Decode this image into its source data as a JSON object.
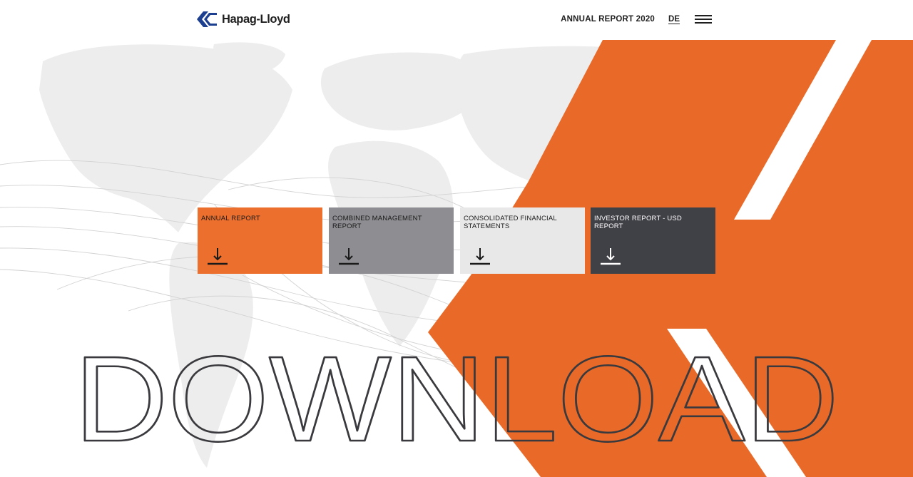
{
  "header": {
    "brand": "Hapag-Lloyd",
    "title": "ANNUAL REPORT 2020",
    "language": "DE"
  },
  "downloads": [
    {
      "label": "ANNUAL REPORT"
    },
    {
      "label": "COMBINED MANAGEMENT REPORT"
    },
    {
      "label": "CONSOLIDATED FINANCIAL STATEMENTS"
    },
    {
      "label": "INVESTOR REPORT - USD REPORT"
    }
  ],
  "hero": {
    "word": "DOWNLOAD"
  },
  "colors": {
    "brand_orange": "#e96a28",
    "brand_navy": "#1d3f8f",
    "tile_orange": "#ec6f2d",
    "tile_mid_grey": "#8e8e92",
    "tile_light_grey": "#e8e8e8",
    "tile_dark": "#404047"
  },
  "icons": {
    "logo": "hapag-lloyd-logo-icon",
    "menu": "hamburger-menu-icon",
    "download": "download-icon"
  }
}
